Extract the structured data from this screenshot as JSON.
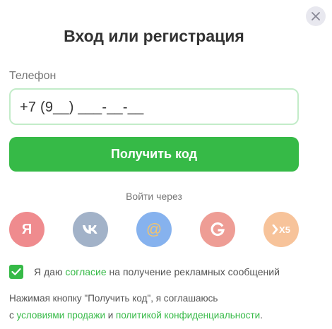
{
  "modal": {
    "title": "Вход или регистрация",
    "phone_label": "Телефон",
    "phone_value": "+7 (9__) ___-__-__",
    "get_code_label": "Получить код",
    "login_via_label": "Войти через"
  },
  "social": [
    {
      "label": "Я",
      "icon": "yandex-icon"
    },
    {
      "label": "",
      "icon": "vk-icon"
    },
    {
      "label": "@",
      "icon": "mail-icon"
    },
    {
      "label": "",
      "icon": "google-icon"
    },
    {
      "label": "X5",
      "icon": "x5-icon"
    }
  ],
  "consent": {
    "checked": true,
    "prefix": "Я даю ",
    "link": "согласие",
    "suffix": " на получение рекламных сообщений"
  },
  "terms": {
    "line1": "Нажимая кнопку \"Получить код\", я соглашаюсь",
    "prefix": "с ",
    "link1": "условиями продажи",
    "middle": " и ",
    "link2": "политикой конфиденциальности",
    "suffix": "."
  },
  "colors": {
    "accent": "#36ba47",
    "input_border": "#c3ecc9",
    "close_bg": "#e8e8ef"
  }
}
